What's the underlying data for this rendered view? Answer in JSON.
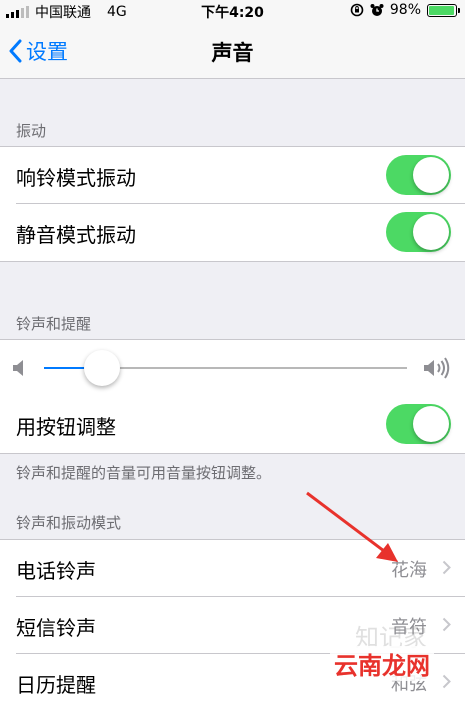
{
  "status_bar": {
    "carrier": "中国联通",
    "network": "4G",
    "time": "下午4:20",
    "battery": "98%",
    "battery_level": 0.98
  },
  "nav": {
    "back_label": "设置",
    "title": "声音"
  },
  "vibration": {
    "header": "振动",
    "ring_vibrate_label": "响铃模式振动",
    "ring_vibrate_on": true,
    "silent_vibrate_label": "静音模式振动",
    "silent_vibrate_on": true
  },
  "ringer": {
    "header": "铃声和提醒",
    "volume_level": 0.16,
    "buttons_label": "用按钮调整",
    "buttons_on": true,
    "footer": "铃声和提醒的音量可用音量按钮调整。"
  },
  "patterns": {
    "header": "铃声和振动模式",
    "items": [
      {
        "label": "电话铃声",
        "value": "花海"
      },
      {
        "label": "短信铃声",
        "value": "音符"
      },
      {
        "label": "日历提醒",
        "value": "和弦"
      }
    ]
  },
  "overlay": {
    "watermark_1": "知记家",
    "watermark_2": "云南龙网",
    "arrow_color": "#e8322c",
    "watermark_color": "#e8322c"
  }
}
